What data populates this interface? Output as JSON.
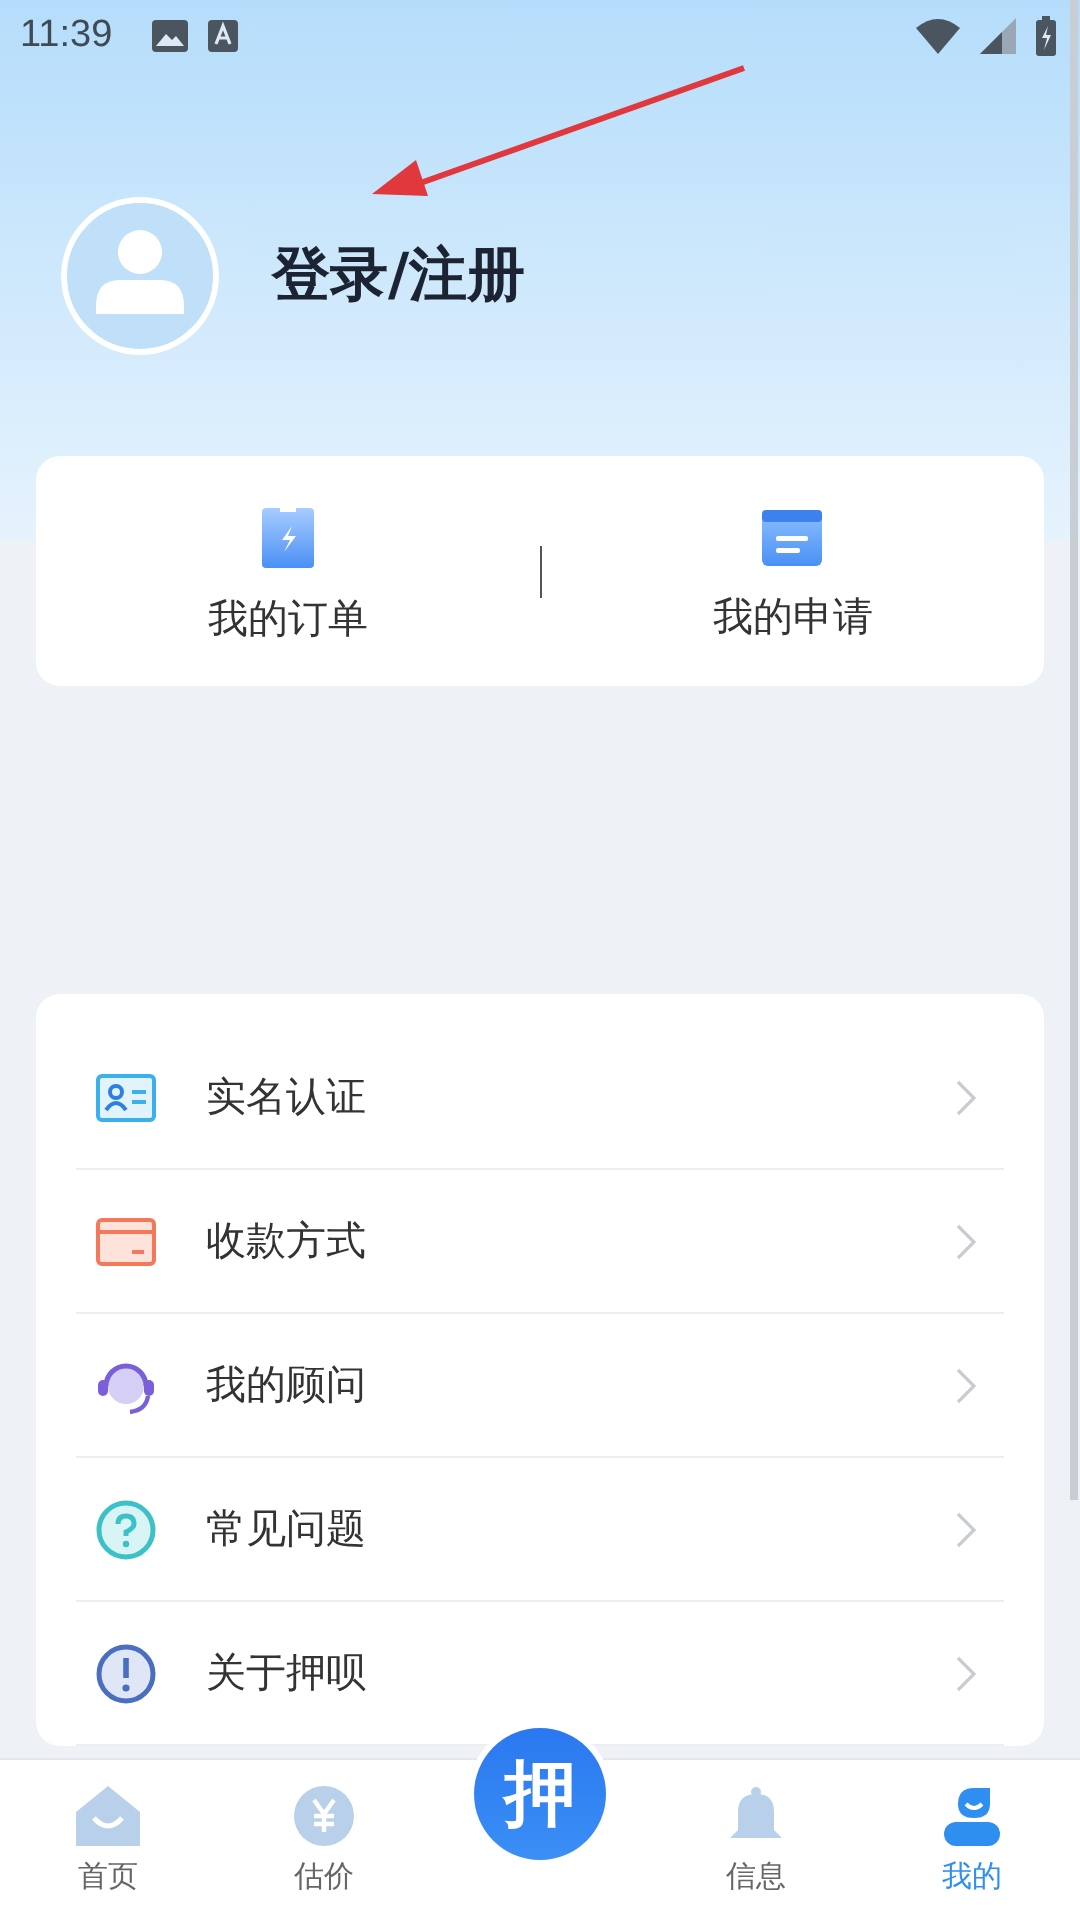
{
  "status_bar": {
    "time": "11:39"
  },
  "profile": {
    "login_label": "登录/注册"
  },
  "quick_actions": [
    {
      "label": "我的订单",
      "kind": "order"
    },
    {
      "label": "我的申请",
      "kind": "application"
    }
  ],
  "menu": [
    {
      "label": "实名认证",
      "kind": "id-card"
    },
    {
      "label": "收款方式",
      "kind": "card"
    },
    {
      "label": "我的顾问",
      "kind": "headset"
    },
    {
      "label": "常见问题",
      "kind": "question"
    },
    {
      "label": "关于押呗",
      "kind": "info"
    }
  ],
  "bottom_nav": {
    "center_button": "押",
    "tabs": [
      {
        "label": "首页",
        "kind": "home",
        "selected": false
      },
      {
        "label": "估价",
        "kind": "price",
        "selected": false
      },
      {
        "label": "信息",
        "kind": "bell",
        "selected": false
      },
      {
        "label": "我的",
        "kind": "me",
        "selected": true
      }
    ]
  }
}
